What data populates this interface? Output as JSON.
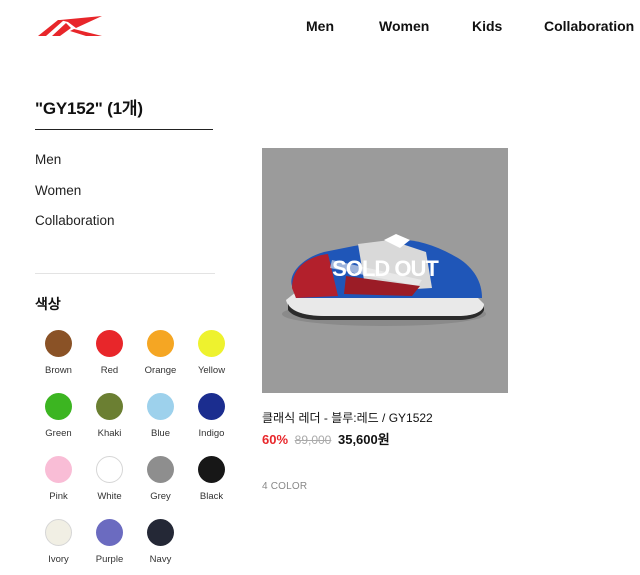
{
  "brand": {
    "accent": "#e8262a"
  },
  "nav": {
    "items": [
      {
        "label": "Men"
      },
      {
        "label": "Women"
      },
      {
        "label": "Kids"
      },
      {
        "label": "Collaboration"
      }
    ]
  },
  "search": {
    "title": "\"GY152\" (1개)"
  },
  "sidebar": {
    "categories": [
      {
        "label": "Men"
      },
      {
        "label": "Women"
      },
      {
        "label": "Collaboration"
      }
    ],
    "color_heading": "색상",
    "colors": [
      {
        "label": "Brown",
        "hex": "#8a5226"
      },
      {
        "label": "Red",
        "hex": "#e8262a"
      },
      {
        "label": "Orange",
        "hex": "#f5a623"
      },
      {
        "label": "Yellow",
        "hex": "#eef22e"
      },
      {
        "label": "Green",
        "hex": "#3cb521"
      },
      {
        "label": "Khaki",
        "hex": "#6b7f32"
      },
      {
        "label": "Blue",
        "hex": "#9dd1ec"
      },
      {
        "label": "Indigo",
        "hex": "#1b2d8f"
      },
      {
        "label": "Pink",
        "hex": "#f9bdd6"
      },
      {
        "label": "White",
        "hex": "#ffffff"
      },
      {
        "label": "Grey",
        "hex": "#8e8e8e"
      },
      {
        "label": "Black",
        "hex": "#171717"
      },
      {
        "label": "Ivory",
        "hex": "#f1efe4"
      },
      {
        "label": "Purple",
        "hex": "#6b6bc0"
      },
      {
        "label": "Navy",
        "hex": "#242836"
      }
    ]
  },
  "product": {
    "status": "SOLD OUT",
    "name": "클래식 레더 - 블루:레드 / GY1522",
    "discount": "60%",
    "original_price": "89,000",
    "sale_price": "35,600원",
    "color_count": "4 COLOR"
  }
}
